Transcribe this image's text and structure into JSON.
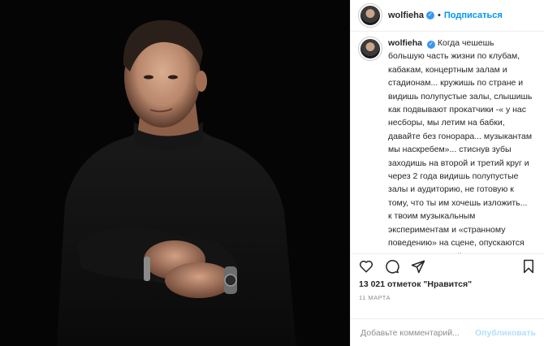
{
  "header": {
    "username": "wolfieha",
    "verified_icon": "verified-badge-icon",
    "separator": "•",
    "follow_label": "Подписаться"
  },
  "caption": {
    "username": "wolfieha",
    "text": "Когда чешешь большую часть жизни по клубам, кабакам, концертным залам и стадионам... кружишь по стране и видишь полупустые залы, слышишь как подвывают прокатчики -« у нас несборы, мы летим на бабки, давайте без гонорара... музыкантам мы наскребем»... стиснув зубы заходишь на второй и третий круг и через 2 года видишь полупустые залы и аудиторию, не готовую к тому, что ты им хочешь изложить... к твоим музыкальным экспериментам и «странному поведению» на сцене, опускаются руки и нет никакой мотивации, остается лишь одно - бесценный многолетний опыт! И вот, в один судьбоносный день, меняешь концепцию шоу и звучания на ту, которую ждали все годы!"
  },
  "actions": {
    "icons": [
      "heart-icon",
      "comment-icon",
      "share-icon",
      "bookmark-icon"
    ]
  },
  "likes": "13 021 отметок \"Нравится\"",
  "date": "11 МАРТА",
  "comment": {
    "placeholder": "Добавьте комментарий...",
    "post_label": "Опубликовать"
  },
  "colors": {
    "accent": "#0095f6",
    "verified": "#3897f0",
    "photo_bg": "#050505"
  }
}
